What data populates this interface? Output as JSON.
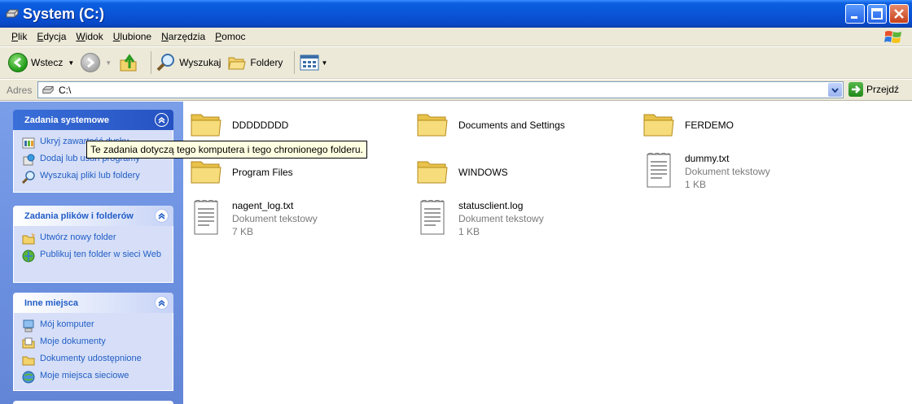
{
  "window": {
    "title": "System (C:)"
  },
  "menu": [
    {
      "u": "P",
      "rest": "lik"
    },
    {
      "u": "E",
      "rest": "dycja"
    },
    {
      "u": "W",
      "rest": "idok"
    },
    {
      "u": "U",
      "rest": "lubione"
    },
    {
      "u": "N",
      "rest": "arzędzia"
    },
    {
      "u": "P",
      "rest": "omoc"
    }
  ],
  "toolbar": {
    "back_label": "Wstecz",
    "search_label": "Wyszukaj",
    "folders_label": "Foldery"
  },
  "address": {
    "label": "Adres",
    "value": "C:\\",
    "go_label": "Przejdź"
  },
  "left_panels": {
    "system": {
      "title": "Zadania systemowe",
      "items": [
        "Ukryj zawartość dysku",
        "Dodaj lub usuń programy",
        "Wyszukaj pliki lub foldery"
      ]
    },
    "files": {
      "title": "Zadania plików i folderów",
      "items": [
        "Utwórz nowy folder",
        "Publikuj ten folder w sieci Web"
      ]
    },
    "places": {
      "title": "Inne miejsca",
      "items": [
        "Mój komputer",
        "Moje dokumenty",
        "Dokumenty udostępnione",
        "Moje miejsca sieciowe"
      ]
    }
  },
  "tooltip": "Te zadania dotyczą tego komputera i tego chronionego folderu.",
  "files": [
    {
      "name": "DDDDDDDD",
      "type": "folder"
    },
    {
      "name": "Documents and Settings",
      "type": "folder"
    },
    {
      "name": "FERDEMO",
      "type": "folder"
    },
    {
      "name": "Program Files",
      "type": "folder"
    },
    {
      "name": "WINDOWS",
      "type": "folder"
    },
    {
      "name": "dummy.txt",
      "type": "file",
      "kind": "Dokument tekstowy",
      "size": "1 KB"
    },
    {
      "name": "nagent_log.txt",
      "type": "file",
      "kind": "Dokument tekstowy",
      "size": "7 KB"
    },
    {
      "name": "statusclient.log",
      "type": "file",
      "kind": "Dokument tekstowy",
      "size": "1 KB"
    }
  ]
}
